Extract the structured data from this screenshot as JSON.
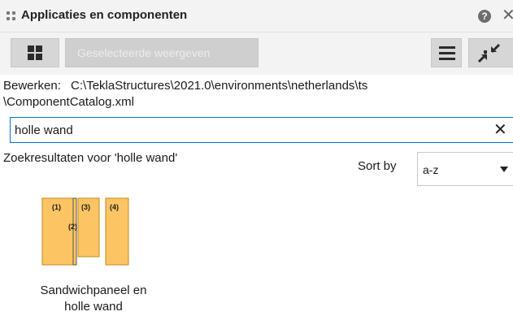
{
  "window": {
    "title": "Applicaties en componenten",
    "title_icon": "grip-dots-icon",
    "help_icon": "help-icon",
    "close_icon": "close-icon",
    "help_glyph": "?",
    "close_glyph": "✕"
  },
  "toolbar": {
    "grid_view_icon": "grid-view-icon",
    "selected_view_label": "Geselecteerde weergeven",
    "menu_icon": "hamburger-menu-icon",
    "collapse_icon": "collapse-arrows-icon"
  },
  "edit": {
    "label": "Bewerken:",
    "path_line1": "C:\\TeklaStructures\\2021.0\\environments\\netherlands\\ts",
    "path_line2": "\\ComponentCatalog.xml"
  },
  "search": {
    "value": "holle wand",
    "clear_glyph": "✕"
  },
  "results": {
    "label": "Zoekresultaten voor 'holle wand'",
    "sort_label": "Sort by",
    "sort_value": "a-z"
  },
  "items": [
    {
      "label_line1": "Sandwichpaneel en",
      "label_line2": "holle wand",
      "icon_labels": [
        "(1)",
        "(2)",
        "(3)",
        "(4)"
      ],
      "icon_color": "#fcc462"
    }
  ],
  "colors": {
    "accent": "#0078d4",
    "panel_fill": "#fcc462"
  }
}
